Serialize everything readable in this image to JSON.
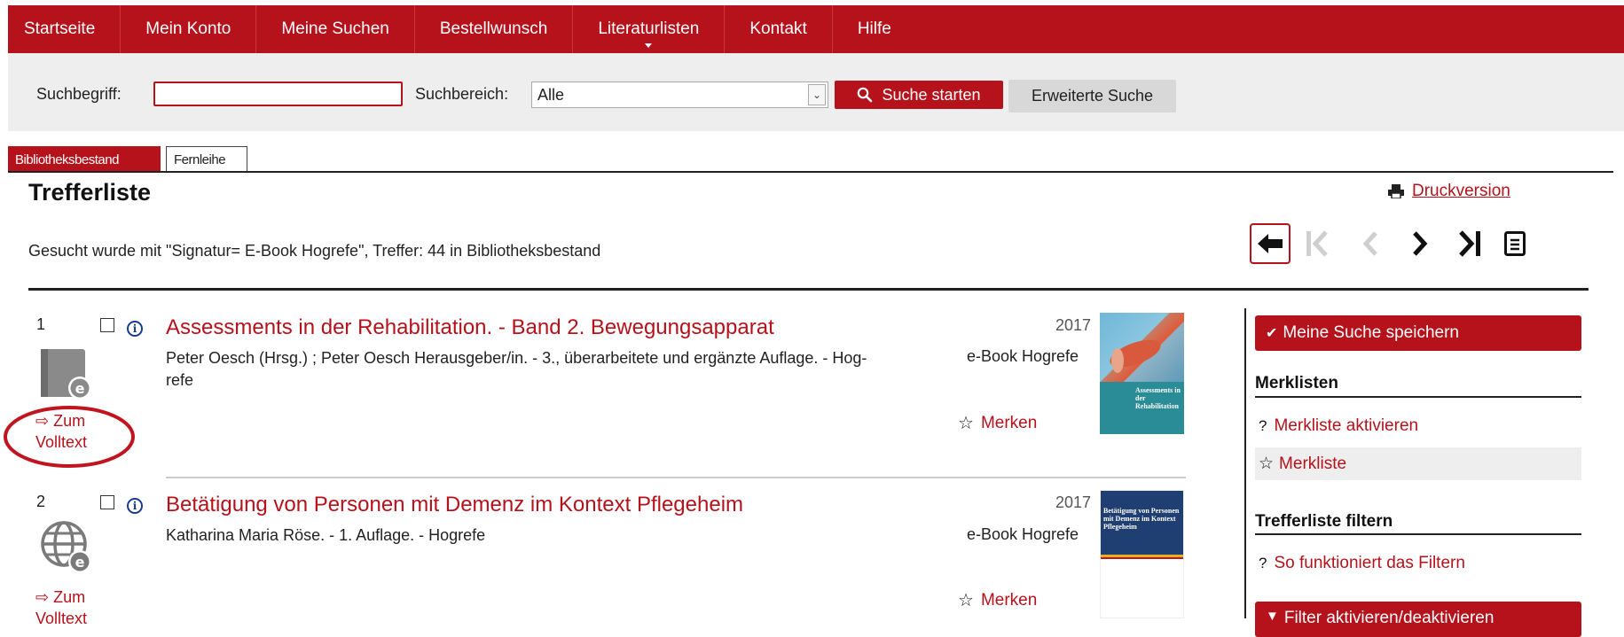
{
  "nav": {
    "items": [
      "Startseite",
      "Mein Konto",
      "Meine Suchen",
      "Bestellwunsch",
      "Literaturlisten",
      "Kontakt",
      "Hilfe"
    ],
    "active_index": 4
  },
  "search": {
    "term_label": "Suchbegriff:",
    "term_value": "",
    "area_label": "Suchbereich:",
    "area_value": "Alle",
    "start_button": "Suche starten",
    "advanced_button": "Erweiterte Suche"
  },
  "tabs": [
    "Bibliotheksbestand",
    "Fernleihe"
  ],
  "results": {
    "title": "Trefferliste",
    "print_link": "Druckversion",
    "summary": "Gesucht wurde mit \"Signatur= E-Book Hogrefe\", Treffer: 44 in Bibliotheksbestand"
  },
  "records": [
    {
      "number": "1",
      "title": "Assessments in der Rehabilitation. - Band 2. Bewegungsapparat",
      "meta_line1": "Peter Oesch (Hrsg.) ; Peter Oesch Herausgeber/in. - 3., überarbeitete und ergänzte Auflage. - Hog-",
      "meta_line2": "refe",
      "year": "2017",
      "source": "e-Book Hogrefe",
      "fulltext_line1": "⇨ Zum",
      "fulltext_line2": "Volltext",
      "save_label": "Merken",
      "cover_text": "Assessments in der Rehabilitation"
    },
    {
      "number": "2",
      "title": "Betätigung von Personen mit Demenz im Kontext Pflegeheim",
      "meta_line1": "Katharina Maria Röse. - 1. Auflage. - Hogrefe",
      "meta_line2": "",
      "year": "2017",
      "source": "e-Book Hogrefe",
      "fulltext_line1": "⇨ Zum",
      "fulltext_line2": "Volltext",
      "save_label": "Merken",
      "cover_text": "Betätigung von Personen mit Demenz im Kontext Pflegeheim"
    }
  ],
  "sidebar": {
    "save_search": "Meine Suche speichern",
    "merklisten_heading": "Merklisten",
    "activate_merkliste": "Merkliste aktivieren",
    "merkliste": "Merkliste",
    "filter_heading": "Trefferliste filtern",
    "filter_help": "So funktioniert das Filtern",
    "filter_toggle": "Filter aktivieren/deaktivieren"
  },
  "colors": {
    "accent": "#b5121b",
    "highlight_circle": "#c0151f"
  }
}
